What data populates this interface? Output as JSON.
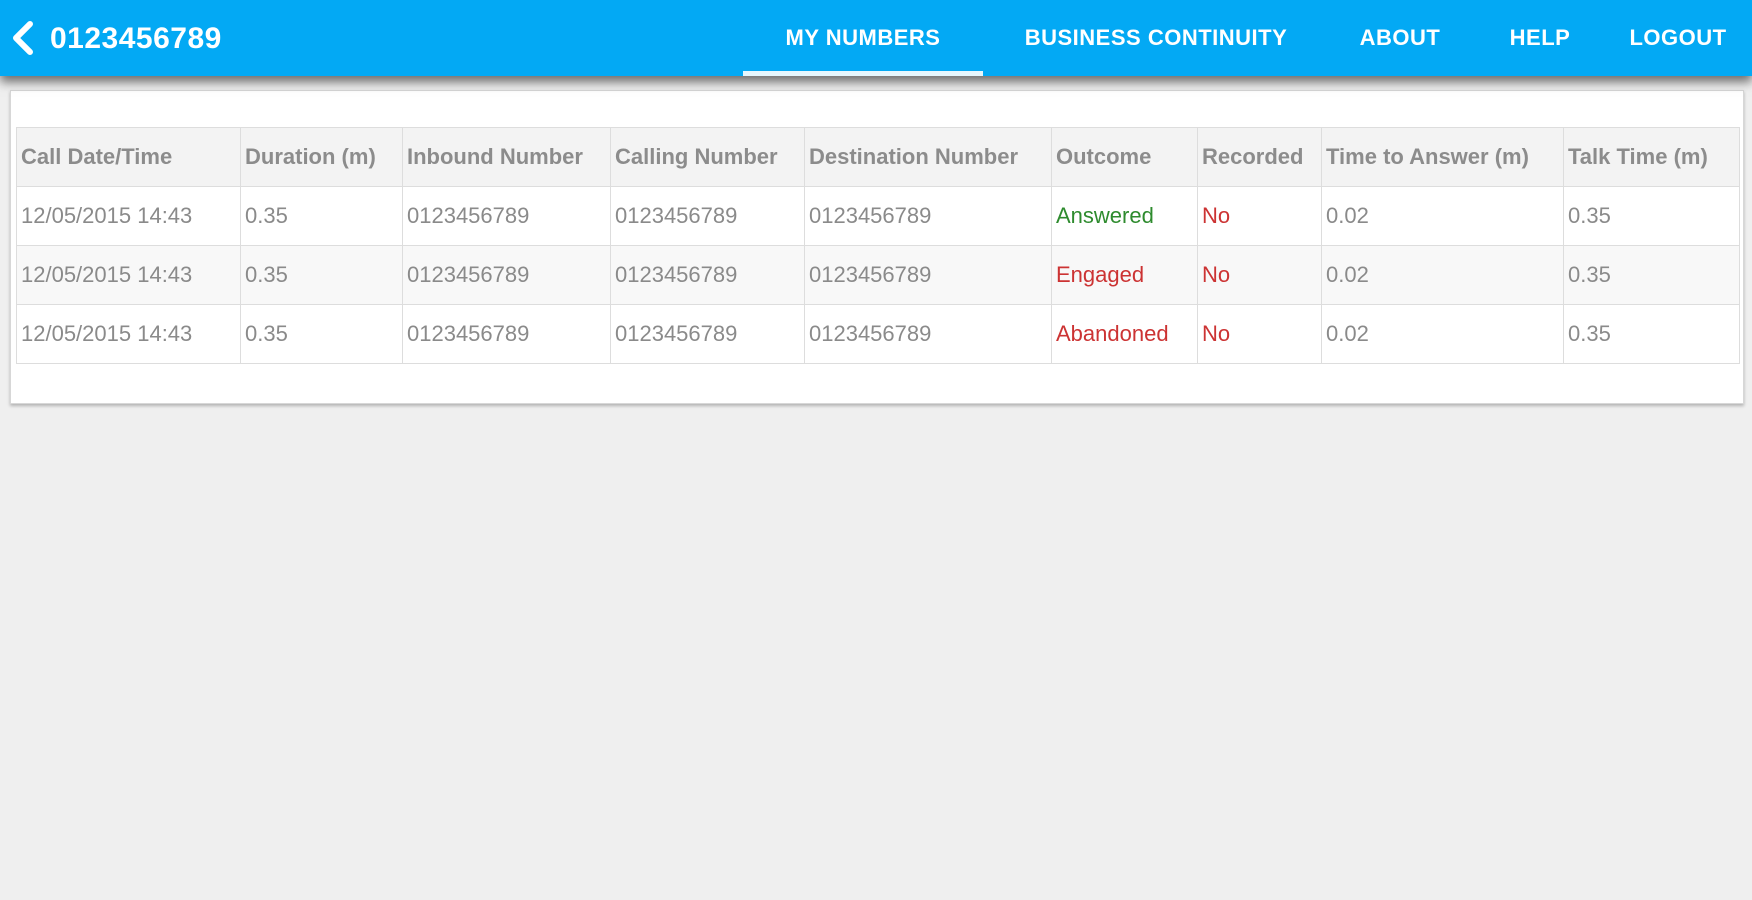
{
  "header": {
    "title": "0123456789",
    "back_icon": "chevron-left-icon"
  },
  "nav": {
    "items": [
      {
        "label": "MY  NUMBERS",
        "active": true
      },
      {
        "label": "BUSINESS  CONTINUITY",
        "active": false
      },
      {
        "label": "ABOUT",
        "active": false
      },
      {
        "label": "HELP",
        "active": false
      },
      {
        "label": "LOGOUT",
        "active": false
      }
    ]
  },
  "table": {
    "columns": [
      "Call Date/Time",
      "Duration (m)",
      "Inbound Number",
      "Calling Number",
      "Destination Number",
      "Outcome",
      "Recorded",
      "Time to Answer (m)",
      "Talk Time (m)"
    ],
    "rows": [
      {
        "datetime": "12/05/2015 14:43",
        "duration": "0.35",
        "inbound": "0123456789",
        "calling": "0123456789",
        "destination": "0123456789",
        "outcome": "Answered",
        "recorded": "No",
        "time_to_answer": "0.02",
        "talk_time": "0.35"
      },
      {
        "datetime": "12/05/2015 14:43",
        "duration": "0.35",
        "inbound": "0123456789",
        "calling": "0123456789",
        "destination": "0123456789",
        "outcome": "Engaged",
        "recorded": "No",
        "time_to_answer": "0.02",
        "talk_time": "0.35"
      },
      {
        "datetime": "12/05/2015 14:43",
        "duration": "0.35",
        "inbound": "0123456789",
        "calling": "0123456789",
        "destination": "0123456789",
        "outcome": "Abandoned",
        "recorded": "No",
        "time_to_answer": "0.02",
        "talk_time": "0.35"
      }
    ]
  },
  "colors": {
    "accent": "#03a9f4",
    "answered": "#2e8b2e",
    "negative": "#cc3333"
  }
}
